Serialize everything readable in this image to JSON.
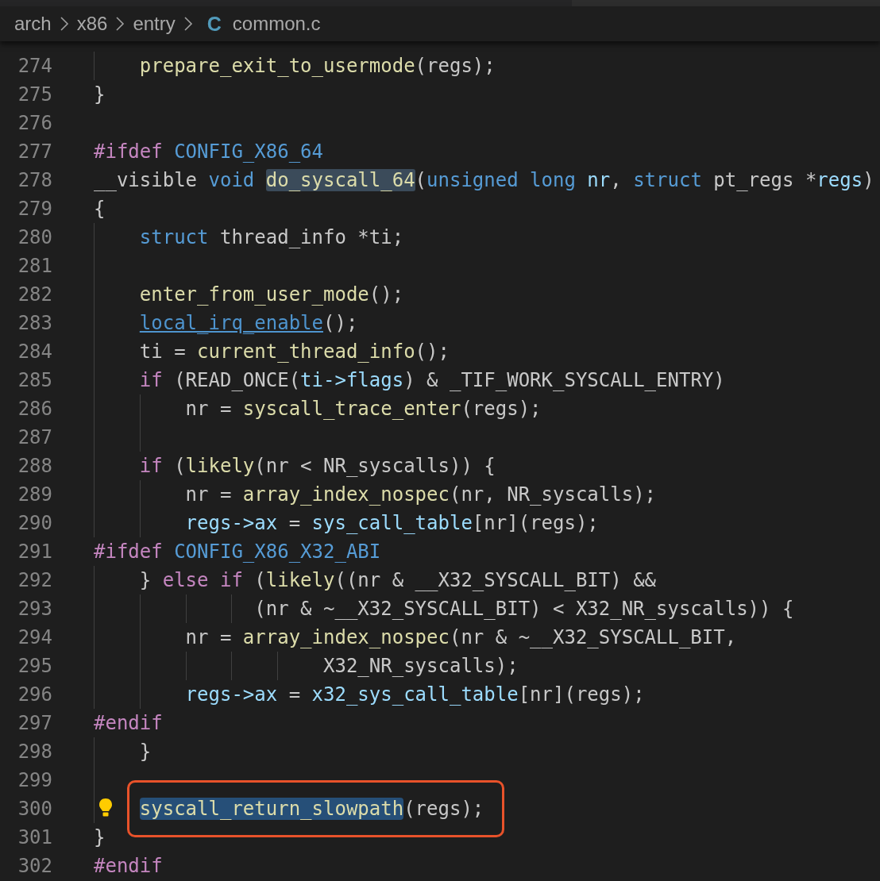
{
  "breadcrumb": [
    {
      "kind": "folder",
      "label": "arch"
    },
    {
      "kind": "folder",
      "label": "x86"
    },
    {
      "kind": "folder",
      "label": "entry"
    },
    {
      "kind": "file",
      "icon_text": "C",
      "label": "common.c"
    }
  ],
  "lines": [
    {
      "n": "274",
      "code": [
        {
          "kind": "function",
          "text": "    prepare_exit_to_usermode"
        },
        {
          "kind": "plain",
          "text": "(regs);"
        }
      ]
    },
    {
      "n": "275",
      "code": [
        {
          "kind": "plain",
          "text": "}"
        }
      ]
    },
    {
      "n": "276"
    },
    {
      "n": "277",
      "code": [
        {
          "kind": "control",
          "text": "#ifdef "
        },
        {
          "kind": "keyword",
          "text": "CONFIG_X86_64"
        }
      ]
    },
    {
      "n": "278",
      "code": [
        {
          "kind": "plain",
          "text": "__visible "
        },
        {
          "kind": "keyword",
          "text": "void "
        },
        {
          "kind": "function",
          "text": "do_syscall_64",
          "highlighted": true
        },
        {
          "kind": "plain",
          "text": "("
        },
        {
          "kind": "keyword",
          "text": "unsigned long "
        },
        {
          "kind": "variable",
          "text": "nr"
        },
        {
          "kind": "plain",
          "text": ", "
        },
        {
          "kind": "keyword",
          "text": "struct"
        },
        {
          "kind": "plain",
          "text": " pt_regs *"
        },
        {
          "kind": "variable",
          "text": "regs"
        },
        {
          "kind": "plain",
          "text": ")"
        }
      ]
    },
    {
      "n": "279",
      "code": [
        {
          "kind": "plain",
          "text": "{"
        }
      ]
    },
    {
      "n": "280",
      "code": [
        {
          "kind": "keyword",
          "text": "    struct"
        },
        {
          "kind": "plain",
          "text": " thread_info *ti;"
        }
      ]
    },
    {
      "n": "281"
    },
    {
      "n": "282",
      "code": [
        {
          "kind": "function",
          "text": "    enter_from_user_mode"
        },
        {
          "kind": "plain",
          "text": "();"
        }
      ]
    },
    {
      "n": "283",
      "code": [
        {
          "kind": "link",
          "text": "    local_irq_enable",
          "underlined": true
        },
        {
          "kind": "plain",
          "text": "();"
        }
      ]
    },
    {
      "n": "284",
      "code": [
        {
          "kind": "plain",
          "text": "    ti = "
        },
        {
          "kind": "function",
          "text": "current_thread_info"
        },
        {
          "kind": "plain",
          "text": "();"
        }
      ]
    },
    {
      "n": "285",
      "code": [
        {
          "kind": "control",
          "text": "    if"
        },
        {
          "kind": "plain",
          "text": " (READ_ONCE("
        },
        {
          "kind": "variable",
          "text": "ti->flags"
        },
        {
          "kind": "plain",
          "text": ") & _TIF_WORK_SYSCALL_ENTRY)"
        }
      ]
    },
    {
      "n": "286",
      "code": [
        {
          "kind": "plain",
          "text": "        nr = "
        },
        {
          "kind": "function",
          "text": "syscall_trace_enter"
        },
        {
          "kind": "plain",
          "text": "(regs);"
        }
      ]
    },
    {
      "n": "287"
    },
    {
      "n": "288",
      "code": [
        {
          "kind": "control",
          "text": "    if"
        },
        {
          "kind": "plain",
          "text": " ("
        },
        {
          "kind": "function",
          "text": "likely"
        },
        {
          "kind": "plain",
          "text": "(nr < NR_syscalls)) {"
        }
      ]
    },
    {
      "n": "289",
      "code": [
        {
          "kind": "plain",
          "text": "        nr = "
        },
        {
          "kind": "function",
          "text": "array_index_nospec"
        },
        {
          "kind": "plain",
          "text": "(nr, NR_syscalls);"
        }
      ]
    },
    {
      "n": "290",
      "code": [
        {
          "kind": "variable",
          "text": "        regs->ax"
        },
        {
          "kind": "plain",
          "text": " = "
        },
        {
          "kind": "variable",
          "text": "sys_call_table"
        },
        {
          "kind": "plain",
          "text": "[nr](regs);"
        }
      ]
    },
    {
      "n": "291",
      "code": [
        {
          "kind": "control",
          "text": "#ifdef "
        },
        {
          "kind": "keyword",
          "text": "CONFIG_X86_X32_ABI"
        }
      ]
    },
    {
      "n": "292",
      "code": [
        {
          "kind": "plain",
          "text": "    } "
        },
        {
          "kind": "control",
          "text": "else if"
        },
        {
          "kind": "plain",
          "text": " ("
        },
        {
          "kind": "function",
          "text": "likely"
        },
        {
          "kind": "plain",
          "text": "((nr & __X32_SYSCALL_BIT) &&"
        }
      ]
    },
    {
      "n": "293",
      "code": [
        {
          "kind": "plain",
          "text": "              (nr & ~__X32_SYSCALL_BIT) < X32_NR_syscalls)) {"
        }
      ]
    },
    {
      "n": "294",
      "code": [
        {
          "kind": "plain",
          "text": "        nr = "
        },
        {
          "kind": "function",
          "text": "array_index_nospec"
        },
        {
          "kind": "plain",
          "text": "(nr & ~__X32_SYSCALL_BIT,"
        }
      ]
    },
    {
      "n": "295",
      "code": [
        {
          "kind": "plain",
          "text": "                    X32_NR_syscalls);"
        }
      ]
    },
    {
      "n": "296",
      "code": [
        {
          "kind": "variable",
          "text": "        regs->ax"
        },
        {
          "kind": "plain",
          "text": " = "
        },
        {
          "kind": "variable",
          "text": "x32_sys_call_table"
        },
        {
          "kind": "plain",
          "text": "[nr](regs);"
        }
      ]
    },
    {
      "n": "297",
      "code": [
        {
          "kind": "control",
          "text": "#endif"
        }
      ]
    },
    {
      "n": "298",
      "code": [
        {
          "kind": "plain",
          "text": "    }"
        }
      ]
    },
    {
      "n": "299"
    },
    {
      "n": "300",
      "bulb": true,
      "boxed": true,
      "code": [
        {
          "kind": "function",
          "text": "    syscall_return_slowpath",
          "selected": true
        },
        {
          "kind": "plain",
          "text": "(regs);"
        }
      ]
    },
    {
      "n": "301",
      "code": [
        {
          "kind": "plain",
          "text": "}"
        }
      ]
    },
    {
      "n": "302",
      "code": [
        {
          "kind": "control",
          "text": "#endif"
        }
      ]
    }
  ]
}
